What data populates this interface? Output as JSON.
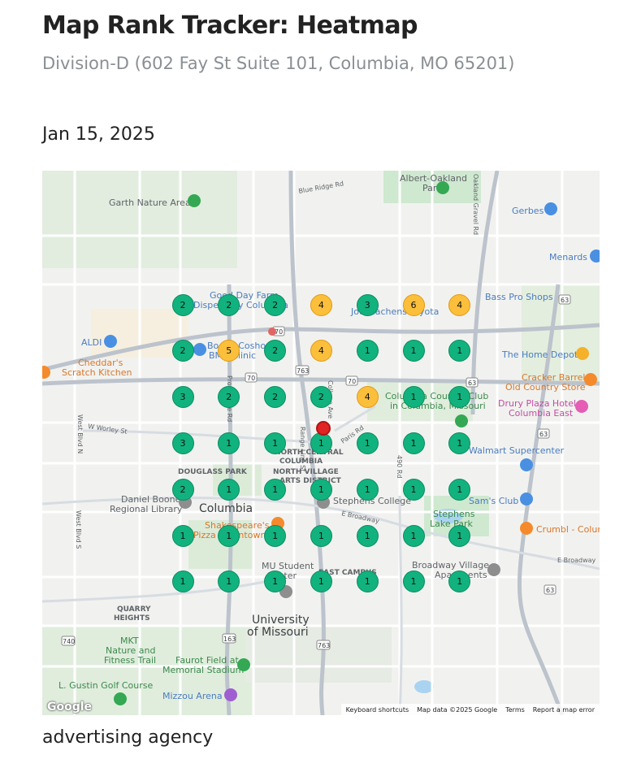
{
  "header": {
    "title": "Map Rank Tracker: Heatmap",
    "subtitle": "Division-D (602 Fay St Suite 101, Columbia, MO 65201)",
    "date": "Jan 15, 2025",
    "keyword": "advertising agency"
  },
  "map": {
    "labels": {
      "albert_oakland": "Albert-Oakland",
      "park": "Park",
      "garth": "Garth Nature Area",
      "blue_ridge": "Blue Ridge Rd",
      "gerbes": "Gerbes",
      "menards": "Menards",
      "bass_pro": "Bass Pro Shops",
      "aldi": "ALDI",
      "cheddars1": "Cheddar's",
      "cheddars2": "Scratch Kitchen",
      "home_depot": "The Home Depot",
      "cracker1": "Cracker Barrel",
      "cracker2": "Old Country Store",
      "drury1": "Drury Plaza Hotel",
      "drury2": "Columbia East",
      "walmart": "Walmart Supercenter",
      "north_central": "NORTH CENTRAL",
      "columbia_caps": "COLUMBIA",
      "douglass": "DOUGLASS PARK",
      "north_village": "NORTH VILLAGE",
      "arts_district": "ARTS DISTRICT",
      "daniel_boone1": "Daniel Boone",
      "daniel_boone2": "Regional Library",
      "columbia": "Columbia",
      "stephens_college": "Stephens College",
      "stephens_lake1": "Stephens",
      "stephens_lake2": "Lake Park",
      "sams": "Sam's Club",
      "crumbl": "Crumbl - Colum",
      "shakespeares1": "Shakespeare's",
      "shakespeares2": "Pizza Downtown",
      "mu_student1": "MU Student",
      "mu_student2": "Center",
      "east_campus": "EAST CAMPUS",
      "broadway_village1": "Broadway Village",
      "broadway_village2": "Apartments",
      "quarry1": "QUARRY",
      "quarry2": "HEIGHTS",
      "university1": "University",
      "university2": "of Missouri",
      "mkt1": "MKT",
      "mkt2": "Nature and",
      "mkt3": "Fitness Trail",
      "faurot1": "Faurot Field at",
      "faurot2": "Memorial Stadium",
      "gustin": "L. Gustin Golf Course",
      "mizzou": "Mizzou Arena",
      "worley": "W Worley St",
      "west_blvd": "West Blvd N",
      "west_blvd_s": "West Blvd S",
      "broadway": "E Broadway",
      "broadway_e": "E Broadway",
      "providence": "Providence Rd",
      "college": "College Ave",
      "paris": "Paris Rd",
      "rte_763": "763",
      "rte_70a": "70",
      "rte_70b": "70",
      "rte_70c": "70",
      "rte_63a": "63",
      "rte_63b": "63",
      "rte_63c": "63",
      "rte_63d": "63",
      "rte_740": "740",
      "rte_763b": "763",
      "rte_163": "163",
      "range_line": "Range Line St",
      "oakland_gravel": "Oakland Gravel Rd",
      "rd_490": "490 Rd",
      "good_day": "Good Day Farm",
      "dispensary": "Dispensary Columbia",
      "joe_machens": "Joe Machens Toyota",
      "boone": "Boone Coshocton",
      "bmc": "BMC Clinic",
      "country_club": "Columbia Country Club",
      "in_columbia": "in Columbia, Missouri"
    },
    "attribution": {
      "logo": "Google",
      "keyboard": "Keyboard shortcuts",
      "map_data": "Map data ©2025 Google",
      "terms": "Terms",
      "report": "Report a map error"
    },
    "grid": [
      [
        "2",
        "2",
        "2",
        "4",
        "3",
        "6",
        "4"
      ],
      [
        "2",
        "5",
        "2",
        "4",
        "1",
        "1",
        "1"
      ],
      [
        "3",
        "2",
        "2",
        "2",
        "4",
        "1",
        "1"
      ],
      [
        "3",
        "1",
        "1",
        "1",
        "1",
        "1",
        "1"
      ],
      [
        "2",
        "1",
        "1",
        "1",
        "1",
        "1",
        "1"
      ],
      [
        "1",
        "1",
        "1",
        "1",
        "1",
        "1",
        "1"
      ],
      [
        "1",
        "1",
        "1",
        "1",
        "1",
        "1",
        "1"
      ]
    ],
    "colors": {
      "top3": "#11b27e",
      "rank4to10": "#fbbf3c",
      "business_pin": "#e02424"
    }
  }
}
